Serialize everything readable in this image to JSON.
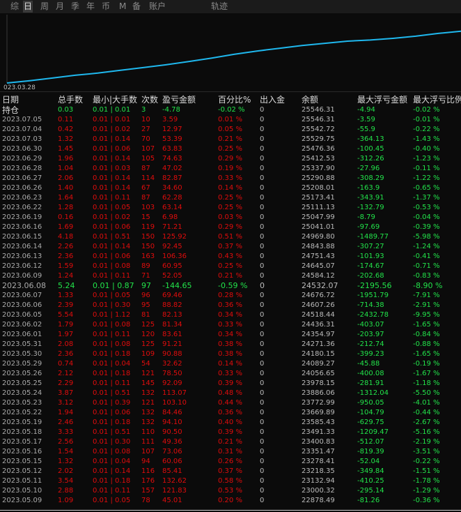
{
  "tabs": [
    {
      "label": "综",
      "active": false
    },
    {
      "label": "日",
      "active": true
    },
    {
      "label": "周",
      "active": false
    },
    {
      "label": "月",
      "active": false
    },
    {
      "label": "季",
      "active": false
    },
    {
      "label": "年",
      "active": false
    },
    {
      "label": "币",
      "active": false
    },
    {
      "label": "M",
      "active": false
    },
    {
      "label": "备",
      "active": false
    },
    {
      "label": "账户",
      "active": false
    },
    {
      "label": "轨迹",
      "active": false
    }
  ],
  "chart": {
    "start_date_label": "023.03.28",
    "line_color": "#1fb8ee",
    "equity_curve": [
      [
        0,
        0.0
      ],
      [
        0.05,
        0.04
      ],
      [
        0.1,
        0.09
      ],
      [
        0.15,
        0.14
      ],
      [
        0.2,
        0.18
      ],
      [
        0.25,
        0.23
      ],
      [
        0.3,
        0.28
      ],
      [
        0.35,
        0.33
      ],
      [
        0.4,
        0.39
      ],
      [
        0.45,
        0.45
      ],
      [
        0.5,
        0.52
      ],
      [
        0.55,
        0.58
      ],
      [
        0.6,
        0.63
      ],
      [
        0.65,
        0.68
      ],
      [
        0.7,
        0.72
      ],
      [
        0.75,
        0.76
      ],
      [
        0.8,
        0.78
      ],
      [
        0.85,
        0.81
      ],
      [
        0.9,
        0.85
      ],
      [
        0.95,
        0.9
      ],
      [
        1.0,
        0.94
      ]
    ]
  },
  "table": {
    "headers": [
      "日期",
      "总手数",
      "最小|大手数",
      "次数",
      "盈亏金额",
      "百分比%",
      "出入金",
      "余额",
      "最大浮亏金额",
      "最大浮亏比例"
    ],
    "holding": {
      "label": "持仓",
      "lots": "0.03",
      "min_max": "0.01 | 0.01",
      "count": "3",
      "pnl": "-4.78",
      "pct": "-0.02 %",
      "io": "0",
      "balance": "25546.31",
      "max_float": "-4.94",
      "max_float_pct": "-0.02 %"
    },
    "rows": [
      {
        "date": "2023.07.05",
        "lots": "0.11",
        "min_max": "0.01 | 0.01",
        "count": "10",
        "pnl": "3.59",
        "pct": "0.01 %",
        "io": "0",
        "balance": "25546.31",
        "max_float": "-3.59",
        "max_float_pct": "-0.01 %"
      },
      {
        "date": "2023.07.04",
        "lots": "0.42",
        "min_max": "0.01 | 0.02",
        "count": "27",
        "pnl": "12.97",
        "pct": "0.05 %",
        "io": "0",
        "balance": "25542.72",
        "max_float": "-55.9",
        "max_float_pct": "-0.22 %"
      },
      {
        "date": "2023.07.03",
        "lots": "1.32",
        "min_max": "0.01 | 0.14",
        "count": "70",
        "pnl": "53.39",
        "pct": "0.21 %",
        "io": "0",
        "balance": "25529.75",
        "max_float": "-364.13",
        "max_float_pct": "-1.43 %"
      },
      {
        "date": "2023.06.30",
        "lots": "1.45",
        "min_max": "0.01 | 0.06",
        "count": "107",
        "pnl": "63.83",
        "pct": "0.25 %",
        "io": "0",
        "balance": "25476.36",
        "max_float": "-100.45",
        "max_float_pct": "-0.40 %"
      },
      {
        "date": "2023.06.29",
        "lots": "1.96",
        "min_max": "0.01 | 0.14",
        "count": "105",
        "pnl": "74.63",
        "pct": "0.29 %",
        "io": "0",
        "balance": "25412.53",
        "max_float": "-312.26",
        "max_float_pct": "-1.23 %"
      },
      {
        "date": "2023.06.28",
        "lots": "1.04",
        "min_max": "0.01 | 0.03",
        "count": "87",
        "pnl": "47.02",
        "pct": "0.19 %",
        "io": "0",
        "balance": "25337.90",
        "max_float": "-27.96",
        "max_float_pct": "-0.11 %"
      },
      {
        "date": "2023.06.27",
        "lots": "2.06",
        "min_max": "0.01 | 0.14",
        "count": "114",
        "pnl": "82.87",
        "pct": "0.33 %",
        "io": "0",
        "balance": "25290.88",
        "max_float": "-308.29",
        "max_float_pct": "-1.22 %"
      },
      {
        "date": "2023.06.26",
        "lots": "1.40",
        "min_max": "0.01 | 0.14",
        "count": "67",
        "pnl": "34.60",
        "pct": "0.14 %",
        "io": "0",
        "balance": "25208.01",
        "max_float": "-163.9",
        "max_float_pct": "-0.65 %"
      },
      {
        "date": "2023.06.23",
        "lots": "1.64",
        "min_max": "0.01 | 0.11",
        "count": "87",
        "pnl": "62.28",
        "pct": "0.25 %",
        "io": "0",
        "balance": "25173.41",
        "max_float": "-343.91",
        "max_float_pct": "-1.37 %"
      },
      {
        "date": "2023.06.22",
        "lots": "1.28",
        "min_max": "0.01 | 0.05",
        "count": "103",
        "pnl": "63.14",
        "pct": "0.25 %",
        "io": "0",
        "balance": "25111.13",
        "max_float": "-132.79",
        "max_float_pct": "-0.53 %"
      },
      {
        "date": "2023.06.19",
        "lots": "0.16",
        "min_max": "0.01 | 0.02",
        "count": "15",
        "pnl": "6.98",
        "pct": "0.03 %",
        "io": "0",
        "balance": "25047.99",
        "max_float": "-8.79",
        "max_float_pct": "-0.04 %"
      },
      {
        "date": "2023.06.16",
        "lots": "1.69",
        "min_max": "0.01 | 0.06",
        "count": "119",
        "pnl": "71.21",
        "pct": "0.29 %",
        "io": "0",
        "balance": "25041.01",
        "max_float": "-97.69",
        "max_float_pct": "-0.39 %"
      },
      {
        "date": "2023.06.15",
        "lots": "4.18",
        "min_max": "0.01 | 0.51",
        "count": "150",
        "pnl": "125.92",
        "pct": "0.51 %",
        "io": "0",
        "balance": "24969.80",
        "max_float": "-1489.77",
        "max_float_pct": "-5.98 %"
      },
      {
        "date": "2023.06.14",
        "lots": "2.26",
        "min_max": "0.01 | 0.14",
        "count": "150",
        "pnl": "92.45",
        "pct": "0.37 %",
        "io": "0",
        "balance": "24843.88",
        "max_float": "-307.27",
        "max_float_pct": "-1.24 %"
      },
      {
        "date": "2023.06.13",
        "lots": "2.36",
        "min_max": "0.01 | 0.06",
        "count": "163",
        "pnl": "106.36",
        "pct": "0.43 %",
        "io": "0",
        "balance": "24751.43",
        "max_float": "-101.93",
        "max_float_pct": "-0.41 %"
      },
      {
        "date": "2023.06.12",
        "lots": "1.59",
        "min_max": "0.01 | 0.08",
        "count": "89",
        "pnl": "60.95",
        "pct": "0.25 %",
        "io": "0",
        "balance": "24645.07",
        "max_float": "-174.67",
        "max_float_pct": "-0.71 %"
      },
      {
        "date": "2023.06.09",
        "lots": "1.24",
        "min_max": "0.01 | 0.11",
        "count": "71",
        "pnl": "52.05",
        "pct": "0.21 %",
        "io": "0",
        "balance": "24584.12",
        "max_float": "-202.68",
        "max_float_pct": "-0.83 %"
      },
      {
        "date": "2023.06.08",
        "lots": "5.24",
        "min_max": "0.01 | 0.87",
        "count": "97",
        "pnl": "-144.65",
        "pct": "-0.59 %",
        "io": "0",
        "balance": "24532.07",
        "max_float": "-2195.56",
        "max_float_pct": "-8.90 %",
        "loss": true
      },
      {
        "date": "2023.06.07",
        "lots": "1.33",
        "min_max": "0.01 | 0.05",
        "count": "96",
        "pnl": "69.46",
        "pct": "0.28 %",
        "io": "0",
        "balance": "24676.72",
        "max_float": "-1951.79",
        "max_float_pct": "-7.91 %"
      },
      {
        "date": "2023.06.06",
        "lots": "2.39",
        "min_max": "0.01 | 0.30",
        "count": "95",
        "pnl": "88.82",
        "pct": "0.36 %",
        "io": "0",
        "balance": "24607.26",
        "max_float": "-714.38",
        "max_float_pct": "-2.91 %"
      },
      {
        "date": "2023.06.05",
        "lots": "5.54",
        "min_max": "0.01 | 1.12",
        "count": "81",
        "pnl": "82.13",
        "pct": "0.34 %",
        "io": "0",
        "balance": "24518.44",
        "max_float": "-2432.78",
        "max_float_pct": "-9.95 %"
      },
      {
        "date": "2023.06.02",
        "lots": "1.79",
        "min_max": "0.01 | 0.08",
        "count": "125",
        "pnl": "81.34",
        "pct": "0.33 %",
        "io": "0",
        "balance": "24436.31",
        "max_float": "-403.07",
        "max_float_pct": "-1.65 %"
      },
      {
        "date": "2023.06.01",
        "lots": "1.97",
        "min_max": "0.01 | 0.11",
        "count": "120",
        "pnl": "83.61",
        "pct": "0.34 %",
        "io": "0",
        "balance": "24354.97",
        "max_float": "-203.97",
        "max_float_pct": "-0.84 %"
      },
      {
        "date": "2023.05.31",
        "lots": "2.08",
        "min_max": "0.01 | 0.08",
        "count": "125",
        "pnl": "91.21",
        "pct": "0.38 %",
        "io": "0",
        "balance": "24271.36",
        "max_float": "-212.74",
        "max_float_pct": "-0.88 %"
      },
      {
        "date": "2023.05.30",
        "lots": "2.36",
        "min_max": "0.01 | 0.18",
        "count": "109",
        "pnl": "90.88",
        "pct": "0.38 %",
        "io": "0",
        "balance": "24180.15",
        "max_float": "-399.23",
        "max_float_pct": "-1.65 %"
      },
      {
        "date": "2023.05.29",
        "lots": "0.74",
        "min_max": "0.01 | 0.04",
        "count": "54",
        "pnl": "32.62",
        "pct": "0.14 %",
        "io": "0",
        "balance": "24089.27",
        "max_float": "-45.88",
        "max_float_pct": "-0.19 %"
      },
      {
        "date": "2023.05.26",
        "lots": "2.12",
        "min_max": "0.01 | 0.18",
        "count": "121",
        "pnl": "78.50",
        "pct": "0.33 %",
        "io": "0",
        "balance": "24056.65",
        "max_float": "-400.08",
        "max_float_pct": "-1.67 %"
      },
      {
        "date": "2023.05.25",
        "lots": "2.29",
        "min_max": "0.01 | 0.11",
        "count": "145",
        "pnl": "92.09",
        "pct": "0.39 %",
        "io": "0",
        "balance": "23978.15",
        "max_float": "-281.91",
        "max_float_pct": "-1.18 %"
      },
      {
        "date": "2023.05.24",
        "lots": "3.87",
        "min_max": "0.01 | 0.51",
        "count": "132",
        "pnl": "113.07",
        "pct": "0.48 %",
        "io": "0",
        "balance": "23886.06",
        "max_float": "-1312.04",
        "max_float_pct": "-5.50 %"
      },
      {
        "date": "2023.05.23",
        "lots": "3.12",
        "min_max": "0.01 | 0.39",
        "count": "121",
        "pnl": "103.10",
        "pct": "0.44 %",
        "io": "0",
        "balance": "23772.99",
        "max_float": "-950.05",
        "max_float_pct": "-4.01 %"
      },
      {
        "date": "2023.05.22",
        "lots": "1.94",
        "min_max": "0.01 | 0.06",
        "count": "132",
        "pnl": "84.46",
        "pct": "0.36 %",
        "io": "0",
        "balance": "23669.89",
        "max_float": "-104.79",
        "max_float_pct": "-0.44 %"
      },
      {
        "date": "2023.05.19",
        "lots": "2.46",
        "min_max": "0.01 | 0.18",
        "count": "132",
        "pnl": "94.10",
        "pct": "0.40 %",
        "io": "0",
        "balance": "23585.43",
        "max_float": "-629.75",
        "max_float_pct": "-2.67 %"
      },
      {
        "date": "2023.05.18",
        "lots": "3.33",
        "min_max": "0.01 | 0.51",
        "count": "110",
        "pnl": "90.50",
        "pct": "0.39 %",
        "io": "0",
        "balance": "23491.33",
        "max_float": "-1209.47",
        "max_float_pct": "-5.16 %"
      },
      {
        "date": "2023.05.17",
        "lots": "2.56",
        "min_max": "0.01 | 0.30",
        "count": "111",
        "pnl": "49.36",
        "pct": "0.21 %",
        "io": "0",
        "balance": "23400.83",
        "max_float": "-512.07",
        "max_float_pct": "-2.19 %"
      },
      {
        "date": "2023.05.16",
        "lots": "1.54",
        "min_max": "0.01 | 0.08",
        "count": "107",
        "pnl": "73.06",
        "pct": "0.31 %",
        "io": "0",
        "balance": "23351.47",
        "max_float": "-819.39",
        "max_float_pct": "-3.51 %"
      },
      {
        "date": "2023.05.15",
        "lots": "1.32",
        "min_max": "0.01 | 0.04",
        "count": "94",
        "pnl": "60.06",
        "pct": "0.26 %",
        "io": "0",
        "balance": "23278.41",
        "max_float": "-52.04",
        "max_float_pct": "-0.22 %"
      },
      {
        "date": "2023.05.12",
        "lots": "2.02",
        "min_max": "0.01 | 0.14",
        "count": "116",
        "pnl": "85.41",
        "pct": "0.37 %",
        "io": "0",
        "balance": "23218.35",
        "max_float": "-349.84",
        "max_float_pct": "-1.51 %"
      },
      {
        "date": "2023.05.11",
        "lots": "3.54",
        "min_max": "0.01 | 0.18",
        "count": "176",
        "pnl": "132.62",
        "pct": "0.58 %",
        "io": "0",
        "balance": "23132.94",
        "max_float": "-410.25",
        "max_float_pct": "-1.78 %"
      },
      {
        "date": "2023.05.10",
        "lots": "2.88",
        "min_max": "0.01 | 0.11",
        "count": "157",
        "pnl": "121.83",
        "pct": "0.53 %",
        "io": "0",
        "balance": "23000.32",
        "max_float": "-295.14",
        "max_float_pct": "-1.29 %"
      },
      {
        "date": "2023.05.09",
        "lots": "1.09",
        "min_max": "0.01 | 0.05",
        "count": "78",
        "pnl": "45.01",
        "pct": "0.20 %",
        "io": "0",
        "balance": "22878.49",
        "max_float": "-81.26",
        "max_float_pct": "-0.36 %"
      }
    ]
  }
}
